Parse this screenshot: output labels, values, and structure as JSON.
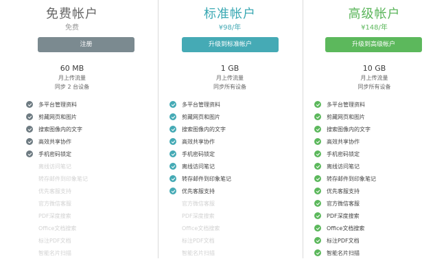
{
  "colors": {
    "free_title": "#666666",
    "standard_title": "#3aa8b3",
    "premium_title": "#5ab55a",
    "free_button": "#7b8a90",
    "standard_button": "#45aab5",
    "premium_button": "#5cb85c",
    "check_free": "#6e7b82",
    "check_standard": "#45aab5",
    "check_premium": "#5cb85c"
  },
  "plans": [
    {
      "title": "免费帐户",
      "price": "免费",
      "button": "注册",
      "storage": "60 MB",
      "upload_note": "月上传流量",
      "sync_note": "同步 2 台设备",
      "features": [
        {
          "label": "多平台管理资料",
          "on": true
        },
        {
          "label": "剪藏网页和图片",
          "on": true
        },
        {
          "label": "搜索图像内的文字",
          "on": true
        },
        {
          "label": "高效共享协作",
          "on": true
        },
        {
          "label": "手机密码锁定",
          "on": true
        },
        {
          "label": "离线访问笔记",
          "on": false
        },
        {
          "label": "转存邮件到印象笔记",
          "on": false
        },
        {
          "label": "优先客服支持",
          "on": false
        },
        {
          "label": "官方微信客服",
          "on": false
        },
        {
          "label": "PDF深度搜索",
          "on": false
        },
        {
          "label": "Office文档搜索",
          "on": false
        },
        {
          "label": "标注PDF文档",
          "on": false
        },
        {
          "label": "智能名片扫描",
          "on": false
        }
      ]
    },
    {
      "title": "标准帐户",
      "price": "¥98/年",
      "button": "升级到标准帐户",
      "storage": "1 GB",
      "upload_note": "月上传流量",
      "sync_note": "同步所有设备",
      "features": [
        {
          "label": "多平台管理资料",
          "on": true
        },
        {
          "label": "剪藏网页和图片",
          "on": true
        },
        {
          "label": "搜索图像内的文字",
          "on": true
        },
        {
          "label": "高效共享协作",
          "on": true
        },
        {
          "label": "手机密码锁定",
          "on": true
        },
        {
          "label": "离线访问笔记",
          "on": true
        },
        {
          "label": "转存邮件到印象笔记",
          "on": true
        },
        {
          "label": "优先客服支持",
          "on": true
        },
        {
          "label": "官方微信客服",
          "on": false
        },
        {
          "label": "PDF深度搜索",
          "on": false
        },
        {
          "label": "Office文档搜索",
          "on": false
        },
        {
          "label": "标注PDF文档",
          "on": false
        },
        {
          "label": "智能名片扫描",
          "on": false
        }
      ]
    },
    {
      "title": "高级帐户",
      "price": "¥148/年",
      "button": "升级到高级帐户",
      "storage": "10 GB",
      "upload_note": "月上传流量",
      "sync_note": "同步所有设备",
      "features": [
        {
          "label": "多平台管理资料",
          "on": true
        },
        {
          "label": "剪藏网页和图片",
          "on": true
        },
        {
          "label": "搜索图像内的文字",
          "on": true
        },
        {
          "label": "高效共享协作",
          "on": true
        },
        {
          "label": "手机密码锁定",
          "on": true
        },
        {
          "label": "离线访问笔记",
          "on": true
        },
        {
          "label": "转存邮件到印象笔记",
          "on": true
        },
        {
          "label": "优先客服支持",
          "on": true
        },
        {
          "label": "官方微信客服",
          "on": true
        },
        {
          "label": "PDF深度搜索",
          "on": true
        },
        {
          "label": "Office文档搜索",
          "on": true
        },
        {
          "label": "标注PDF文档",
          "on": true
        },
        {
          "label": "智能名片扫描",
          "on": true
        }
      ]
    }
  ]
}
